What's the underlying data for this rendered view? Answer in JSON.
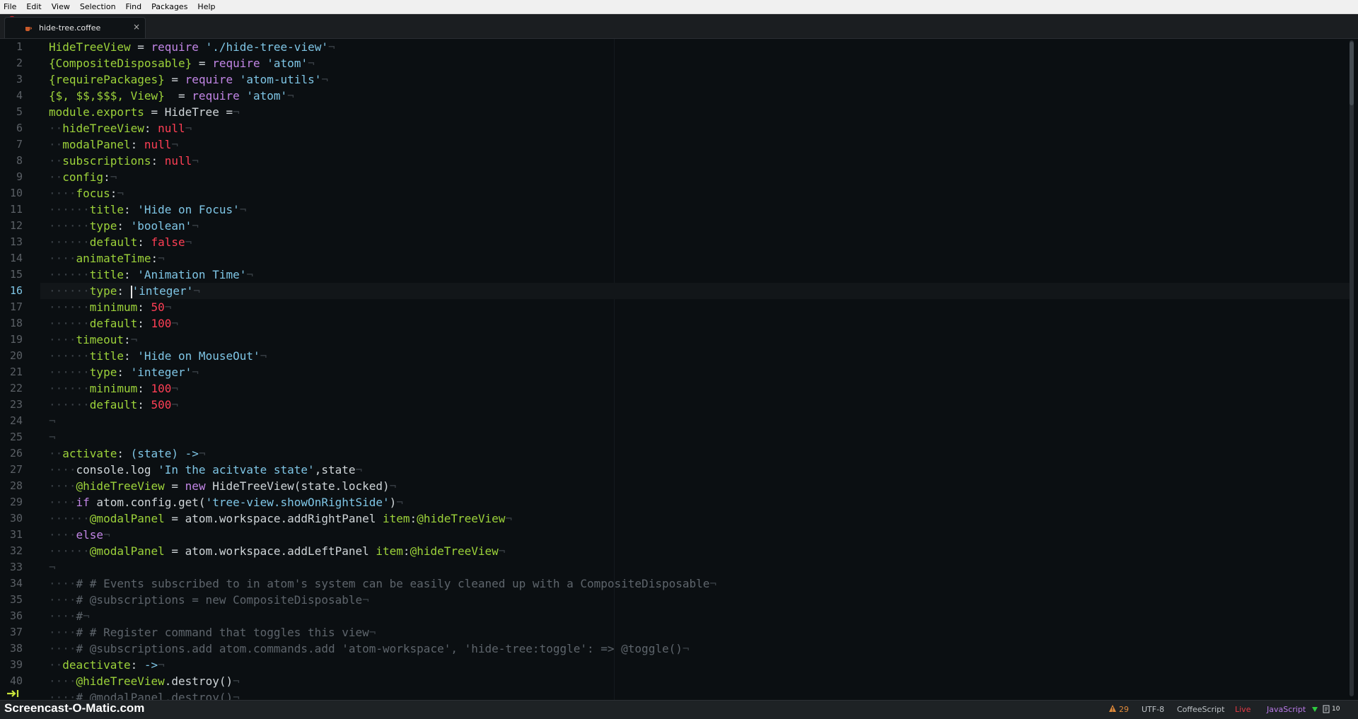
{
  "menu": [
    "File",
    "Edit",
    "View",
    "Selection",
    "Find",
    "Packages",
    "Help"
  ],
  "tab": {
    "title": "hide-tree.coffee",
    "close": "×"
  },
  "gutter": {
    "line_numbers": [
      "1",
      "2",
      "3",
      "4",
      "5",
      "6",
      "7",
      "8",
      "9",
      "10",
      "11",
      "12",
      "13",
      "14",
      "15",
      "16",
      "17",
      "18",
      "19",
      "20",
      "21",
      "22",
      "23",
      "24",
      "25",
      "26",
      "27",
      "28",
      "29",
      "30",
      "31",
      "32",
      "33",
      "34",
      "35",
      "36",
      "37",
      "38",
      "39",
      "40"
    ],
    "current_line": "16"
  },
  "code_lines": [
    "HideTreeView = require './hide-tree-view'",
    "{CompositeDisposable} = require 'atom'",
    "{requirePackages} = require 'atom-utils'",
    "{$, $$,$$$, View}  = require 'atom'",
    "module.exports = HideTree =",
    "  hideTreeView: null",
    "  modalPanel: null",
    "  subscriptions: null",
    "  config:",
    "    focus:",
    "      title: 'Hide on Focus'",
    "      type: 'boolean'",
    "      default: false",
    "    animateTime:",
    "      title: 'Animation Time'",
    "      type: 'integer'",
    "      minimum: 50",
    "      default: 100",
    "    timeout:",
    "      title: 'Hide on MouseOut'",
    "      type: 'integer'",
    "      minimum: 100",
    "      default: 500",
    "",
    "",
    "  activate: (state) ->",
    "    console.log 'In the acitvate state',state",
    "    @hideTreeView = new HideTreeView(state.locked)",
    "    if atom.config.get('tree-view.showOnRightSide')",
    "      @modalPanel = atom.workspace.addRightPanel item:@hideTreeView",
    "    else",
    "      @modalPanel = atom.workspace.addLeftPanel item:@hideTreeView",
    "",
    "    # # Events subscribed to in atom's system can be easily cleaned up with a CompositeDisposable",
    "    # @subscriptions = new CompositeDisposable",
    "    #",
    "    # # Register command that toggles this view",
    "    # @subscriptions.add atom.commands.add 'atom-workspace', 'hide-tree:toggle': => @toggle()",
    "  deactivate: ->",
    "    @hideTreeView.destroy()",
    "    # @modalPanel.destroy()"
  ],
  "status": {
    "watermark": "Screencast-O-Matic.com",
    "warnings": "29",
    "encoding": "UTF-8",
    "grammar": "CoffeeScript",
    "live": "Live",
    "language": "JavaScript",
    "doc_count": "10"
  },
  "colors": {
    "identifier": "#9dd33a",
    "keyword": "#c286e6",
    "string": "#7fc6e6",
    "number": "#ff3f55",
    "comment": "#5e656c"
  }
}
